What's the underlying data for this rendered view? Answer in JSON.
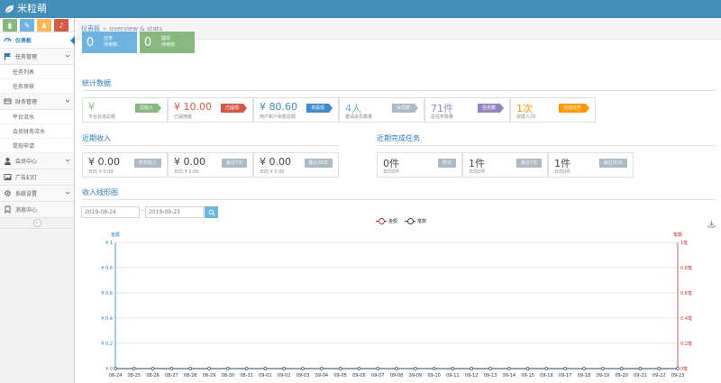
{
  "app": {
    "title": "米粒萌"
  },
  "sidebar": {
    "items": [
      {
        "label": "仪表板",
        "icon": "dashboard-icon"
      },
      {
        "label": "任务管理",
        "icon": "flag-icon",
        "children": [
          "任务列表",
          "任务审核"
        ]
      },
      {
        "label": "财务管理",
        "icon": "finance-icon",
        "children": [
          "平台流水",
          "会员财务流水",
          "提现申请"
        ]
      },
      {
        "label": "会员中心",
        "icon": "user-icon"
      },
      {
        "label": "广告幻灯",
        "icon": "picture-icon"
      },
      {
        "label": "系统设置",
        "icon": "gear-icon"
      },
      {
        "label": "消息中心",
        "icon": "bookmark-icon"
      }
    ]
  },
  "breadcrumb": {
    "home": "仪表板",
    "sep": "»",
    "desc": "overview & stats"
  },
  "tiles": [
    {
      "num": "0",
      "line1": "任务",
      "line2": "待审核",
      "color": "#6fb3e0"
    },
    {
      "num": "0",
      "line1": "提现",
      "line2": "待审核",
      "color": "#87b87f"
    }
  ],
  "stats": {
    "title": "统计数据",
    "cards": [
      {
        "value": "¥",
        "label": "平台充值总额",
        "tag": "总收入",
        "tag_color": "#87b87f",
        "value_color": "#87b87f"
      },
      {
        "value": "¥ 10.00",
        "label": "已提佣金",
        "tag": "已提现",
        "tag_color": "#d15b47",
        "value_color": "#d15b47"
      },
      {
        "value": "¥ 80.60",
        "label": "用户账户余额总额",
        "tag": "未提现",
        "tag_color": "#428bca",
        "value_color": "#428bca"
      },
      {
        "value": "4人",
        "label": "邀请会员数量",
        "tag": "会员数",
        "tag_color": "#abbac3",
        "value_color": "#6fb3e0"
      },
      {
        "value": "71件",
        "label": "总任务数量",
        "tag": "任务数",
        "tag_color": "#9585bf",
        "value_color": "#9585bf"
      },
      {
        "value": "1次",
        "label": "完成人/次",
        "tag": "完成任务",
        "tag_color": "#ff9900",
        "value_color": "#ff9900"
      }
    ]
  },
  "income": {
    "title": "近期收入",
    "cards": [
      {
        "value": "¥ 0.00",
        "label": "日均 ¥ 0.00",
        "tag": "昨日收入"
      },
      {
        "value": "¥ 0.00",
        "label": "日均 ¥ 0.00",
        "tag": "最近7日"
      },
      {
        "value": "¥ 0.00",
        "label": "日均 ¥ 0.00",
        "tag": "最近30日"
      }
    ]
  },
  "tasks": {
    "title": "近期完成任务",
    "cards": [
      {
        "value": "0件",
        "label": "日均0件",
        "tag": "昨日"
      },
      {
        "value": "1件",
        "label": "日均0件",
        "tag": "最近7日"
      },
      {
        "value": "1件",
        "label": "日均0件",
        "tag": "最近30日"
      }
    ]
  },
  "chart_section": {
    "title": "收入线形图",
    "start_date": "2019-08-24",
    "end_date": "2019-09-23",
    "range_sep": "-"
  },
  "chart_data": {
    "type": "line",
    "legend": [
      "金额",
      "笔数"
    ],
    "legend_position": "top-center",
    "y_left_label": "金额",
    "y_right_label": "笔数",
    "y_left_ticks": [
      "¥ 0",
      "¥ 0.2",
      "¥ 0.4",
      "¥ 0.6",
      "¥ 0.8",
      "¥ 1"
    ],
    "y_right_ticks": [
      "0笔",
      "0.2笔",
      "0.4笔",
      "0.6笔",
      "0.8笔",
      "1笔"
    ],
    "ylim": [
      0,
      1
    ],
    "grid": true,
    "categories": [
      "08-24",
      "08-25",
      "08-26",
      "08-27",
      "08-28",
      "08-29",
      "08-30",
      "08-31",
      "09-01",
      "09-02",
      "09-03",
      "09-04",
      "09-05",
      "09-06",
      "09-07",
      "09-08",
      "09-09",
      "09-10",
      "09-11",
      "09-12",
      "09-13",
      "09-14",
      "09-15",
      "09-16",
      "09-17",
      "09-18",
      "09-19",
      "09-20",
      "09-21",
      "09-22",
      "09-23"
    ],
    "series": [
      {
        "name": "金额",
        "color": "#c23531",
        "values": [
          0,
          0,
          0,
          0,
          0,
          0,
          0,
          0,
          0,
          0,
          0,
          0,
          0,
          0,
          0,
          0,
          0,
          0,
          0,
          0,
          0,
          0,
          0,
          0,
          0,
          0,
          0,
          0,
          0,
          0,
          0
        ]
      },
      {
        "name": "笔数",
        "color": "#2f4554",
        "values": [
          0,
          0,
          0,
          0,
          0,
          0,
          0,
          0,
          0,
          0,
          0,
          0,
          0,
          0,
          0,
          0,
          0,
          0,
          0,
          0,
          0,
          0,
          0,
          0,
          0,
          0,
          0,
          0,
          0,
          0,
          0
        ]
      }
    ]
  }
}
